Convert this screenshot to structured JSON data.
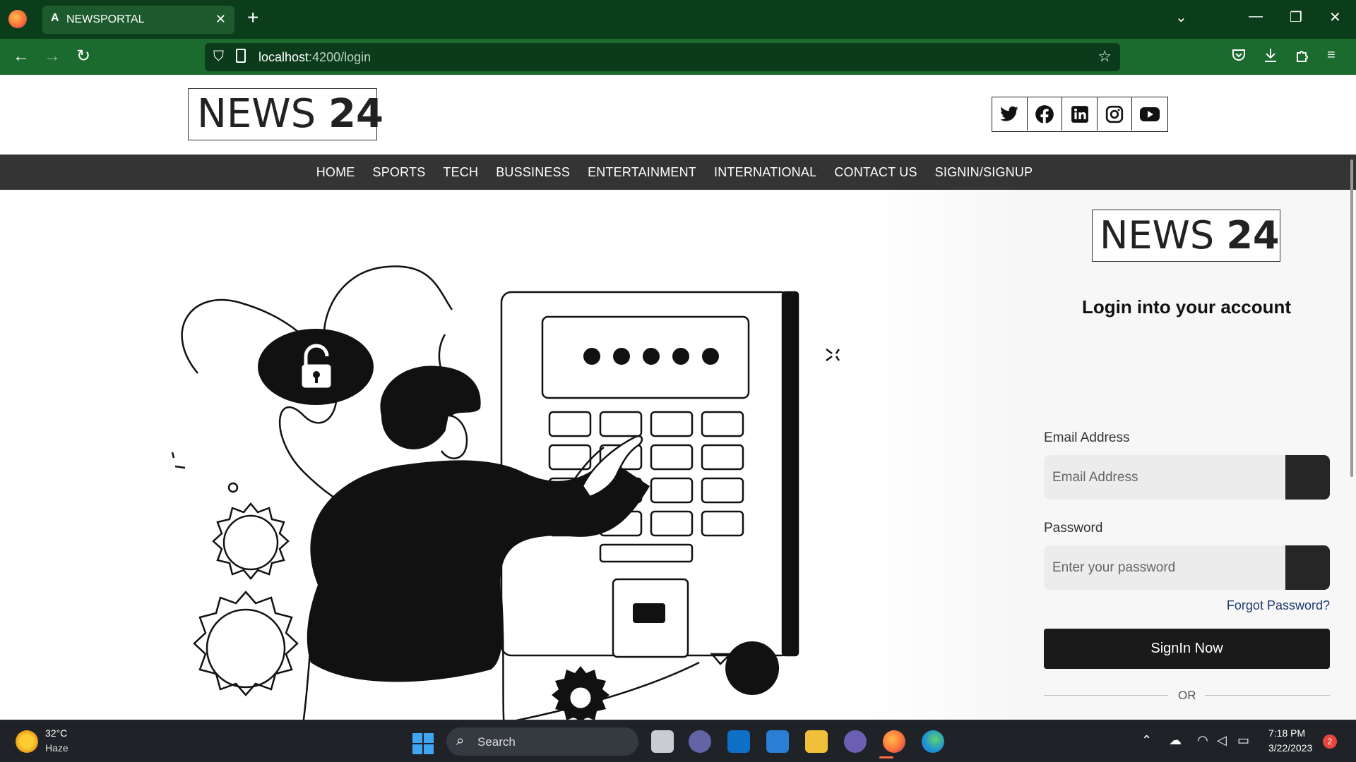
{
  "browser": {
    "tab_icon": "A",
    "tab_title": "NEWSPORTAL",
    "url_host": "localhost",
    "url_path": ":4200/login",
    "accent": "#1c6b2e"
  },
  "header": {
    "logo_light": "NEWS",
    "logo_bold": "24",
    "socials": [
      "twitter-icon",
      "facebook-icon",
      "linkedin-icon",
      "instagram-icon",
      "youtube-icon"
    ]
  },
  "menu": {
    "items": [
      "HOME",
      "SPORTS",
      "TECH",
      "BUSSINESS",
      "ENTERTAINMENT",
      "INTERNATIONAL",
      "CONTACT US",
      "SIGNIN/SIGNUP"
    ]
  },
  "login": {
    "logo_light": "NEWS",
    "logo_bold": "24",
    "title": "Login into your account",
    "email_label": "Email Address",
    "email_placeholder": "Email Address",
    "password_label": "Password",
    "password_placeholder": "Enter your password",
    "forgot": "Forgot Password?",
    "signin": "SignIn Now",
    "or": "OR"
  },
  "taskbar": {
    "temp": "32°C",
    "condition": "Haze",
    "search": "Search",
    "time": "7:18 PM",
    "date": "3/22/2023",
    "notifications": "2"
  }
}
